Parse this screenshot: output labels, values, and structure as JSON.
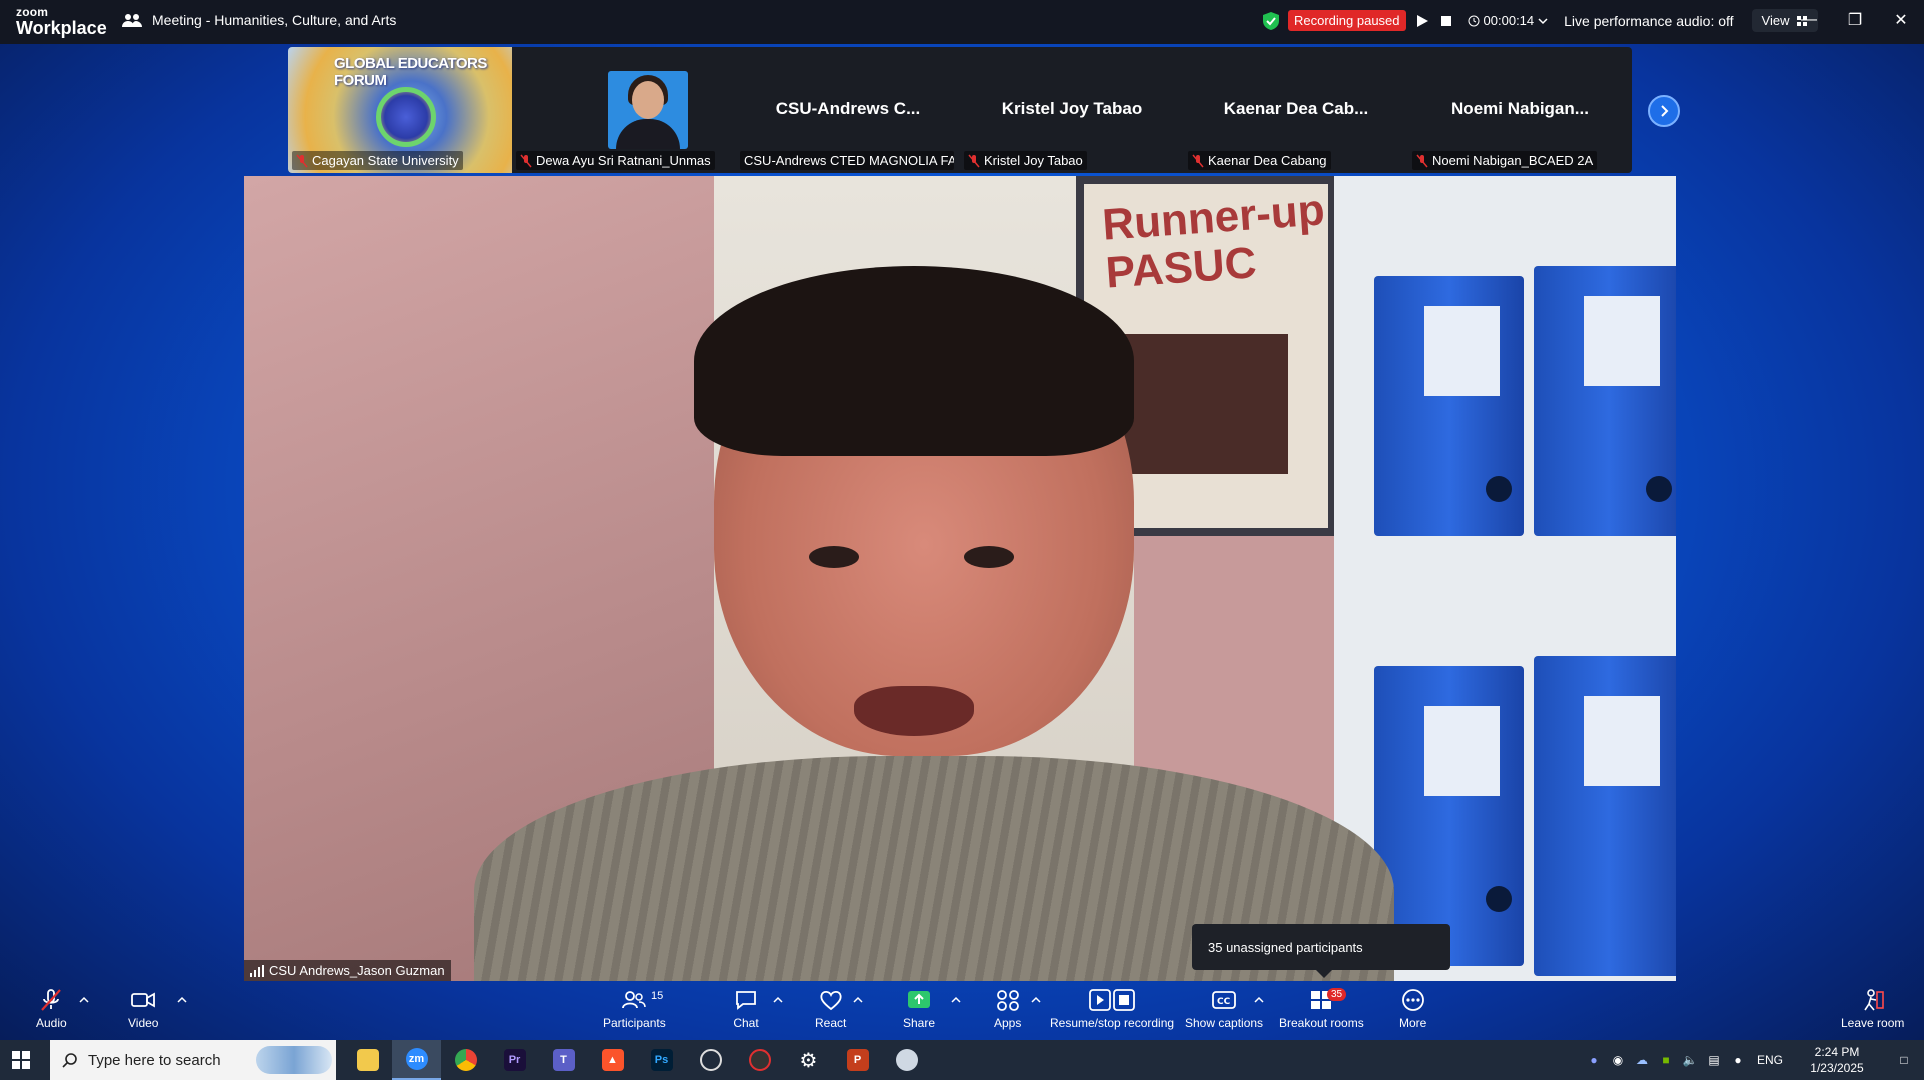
{
  "app": {
    "logo_line1": "zoom",
    "logo_line2": "Workplace",
    "meeting_title": "Meeting - Humanities, Culture, and Arts"
  },
  "recording": {
    "status": "Recording paused",
    "timer": "00:00:14",
    "live_audio": "Live performance audio: off",
    "view_label": "View"
  },
  "strip": {
    "tiles": [
      {
        "label": "Cagayan State University",
        "banner": "GLOBAL EDUCATORS FORUM"
      },
      {
        "label": "Dewa Ayu Sri Ratnani_Unmas"
      },
      {
        "big_name": "CSU-Andrews  C...",
        "label": "CSU-Andrews CTED MAGNOLIA FA..."
      },
      {
        "big_name": "Kristel Joy Tabao",
        "label": "Kristel Joy Tabao"
      },
      {
        "big_name": "Kaenar  Dea  Cab...",
        "label": "Kaenar Dea Cabang"
      },
      {
        "big_name": "Noemi  Nabigan...",
        "label": "Noemi Nabigan_BCAED 2A"
      }
    ]
  },
  "video": {
    "speaker_label": "CSU Andrews_Jason Guzman",
    "poster_text_1": "Runner-up",
    "poster_text_2": "PASUC"
  },
  "tooltip": {
    "text": "35 unassigned participants"
  },
  "toolbar": {
    "audio": "Audio",
    "video": "Video",
    "participants": "Participants",
    "participants_count": "15",
    "chat": "Chat",
    "react": "React",
    "share": "Share",
    "apps": "Apps",
    "recording": "Resume/stop recording",
    "captions": "Show captions",
    "breakout": "Breakout rooms",
    "breakout_count": "35",
    "more": "More",
    "leave": "Leave room"
  },
  "taskbar": {
    "search_placeholder": "Type here to search",
    "lang": "ENG",
    "time": "2:24 PM",
    "date": "1/23/2025"
  },
  "colors": {
    "accent_blue": "#0b6ef0",
    "recording_red": "#e02828",
    "titlebar_bg": "#131722",
    "shield_green": "#20c050"
  }
}
